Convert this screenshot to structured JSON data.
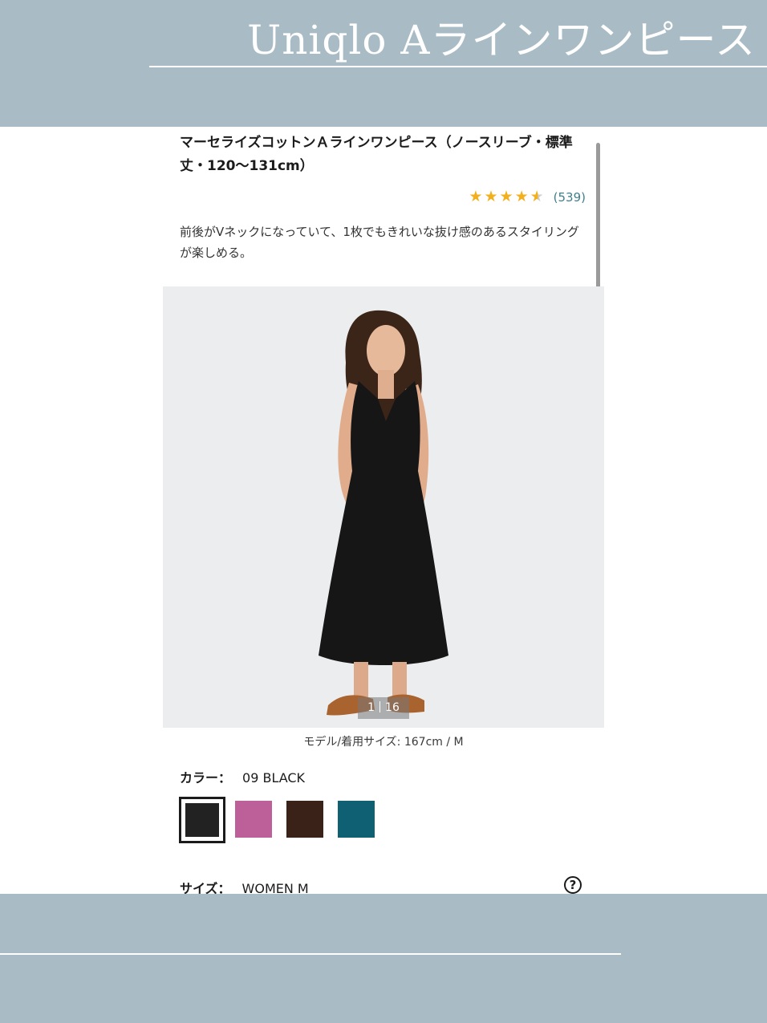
{
  "banner": {
    "title": "Uniqlo Aラインワンピース"
  },
  "product": {
    "title": "マーセライズコットンＡラインワンピース（ノースリーブ・標準丈・120〜131cm）",
    "rating": 4.5,
    "review_count": "(539)",
    "description": "前後がVネックになっていて、1枚でもきれいな抜け感のあるスタイリングが楽しめる。"
  },
  "photo": {
    "current": "1",
    "total": "16",
    "model_info": "モデル/着用サイズ: 167cm / M"
  },
  "color": {
    "label": "カラー：",
    "selected": "09 BLACK",
    "swatches": [
      {
        "name": "black",
        "hex": "#222222",
        "selected": true
      },
      {
        "name": "pink",
        "hex": "#bd5f98",
        "selected": false
      },
      {
        "name": "brown",
        "hex": "#3a2219",
        "selected": false
      },
      {
        "name": "teal",
        "hex": "#0f6073",
        "selected": false
      }
    ]
  },
  "size": {
    "label": "サイズ：",
    "selected": "WOMEN M",
    "help_icon": "question-circle-icon",
    "help_glyph": "?"
  },
  "theme": {
    "band_color": "#a9bbc5",
    "star_color": "#f2b01e",
    "link_color": "#3f7f8c"
  }
}
